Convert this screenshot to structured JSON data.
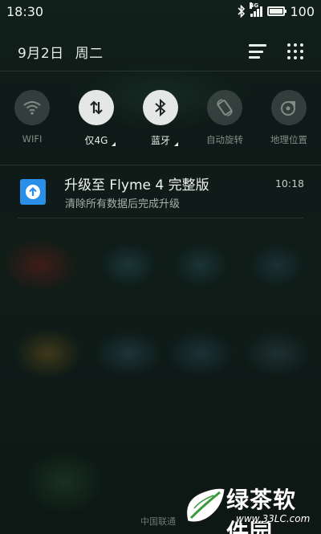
{
  "status_bar": {
    "time": "18:30",
    "network_type": "4G",
    "battery_level": "100"
  },
  "header": {
    "date": "9月2日",
    "weekday": "周二"
  },
  "toggles": [
    {
      "label": "WIFI",
      "icon": "wifi-icon",
      "active": false,
      "has_menu": false
    },
    {
      "label": "仅4G",
      "icon": "data-transfer-icon",
      "active": true,
      "has_menu": true
    },
    {
      "label": "蓝牙",
      "icon": "bluetooth-icon",
      "active": true,
      "has_menu": true
    },
    {
      "label": "自动旋转",
      "icon": "auto-rotate-icon",
      "active": false,
      "has_menu": false
    },
    {
      "label": "地理位置",
      "icon": "location-icon",
      "active": false,
      "has_menu": false
    }
  ],
  "notification": {
    "title": "升级至 Flyme 4 完整版",
    "subtitle": "清除所有数据后完成升级",
    "time": "10:18",
    "icon": "upgrade-arrow-icon",
    "icon_color": "#2a8fe8"
  },
  "footer": {
    "carrier": "中国联通"
  },
  "watermark": {
    "brand": "绿茶软件园",
    "url": "www.33LC.com"
  }
}
